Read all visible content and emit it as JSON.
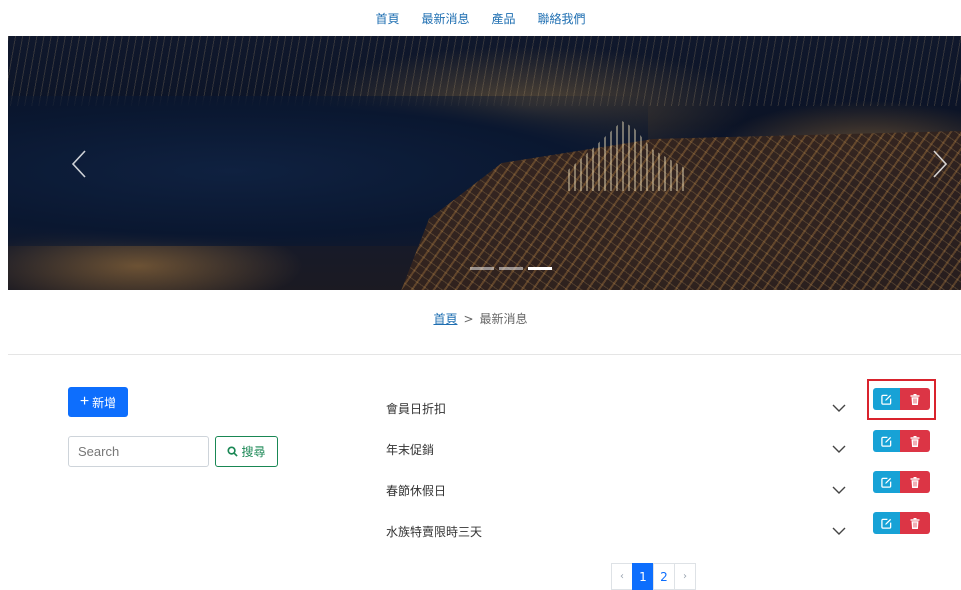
{
  "nav": {
    "items": [
      {
        "label": "首頁"
      },
      {
        "label": "最新消息"
      },
      {
        "label": "產品"
      },
      {
        "label": "聯絡我們"
      }
    ]
  },
  "carousel": {
    "prev_icon": "chevron-left",
    "next_icon": "chevron-right",
    "slide_count": 3,
    "active_index": 3
  },
  "breadcrumb": {
    "home": "首頁",
    "separator": ">",
    "current": "最新消息"
  },
  "toolbar": {
    "add_label": "新增",
    "search_placeholder": "Search",
    "search_label": "搜尋"
  },
  "news": {
    "items": [
      {
        "title": "會員日折扣"
      },
      {
        "title": "年末促銷"
      },
      {
        "title": "春節休假日"
      },
      {
        "title": "水族特賣限時三天"
      }
    ],
    "edit_icon": "edit-icon",
    "delete_icon": "trash-icon",
    "edit_color": "#17a2d6",
    "delete_color": "#dc3545"
  },
  "pagination": {
    "prev": "‹",
    "pages": [
      "1",
      "2"
    ],
    "active_page": "1",
    "next": "›"
  },
  "colors": {
    "primary": "#0d6efd",
    "success": "#198754",
    "nav_link": "#1f6fb2",
    "highlight": "#d9232d"
  }
}
